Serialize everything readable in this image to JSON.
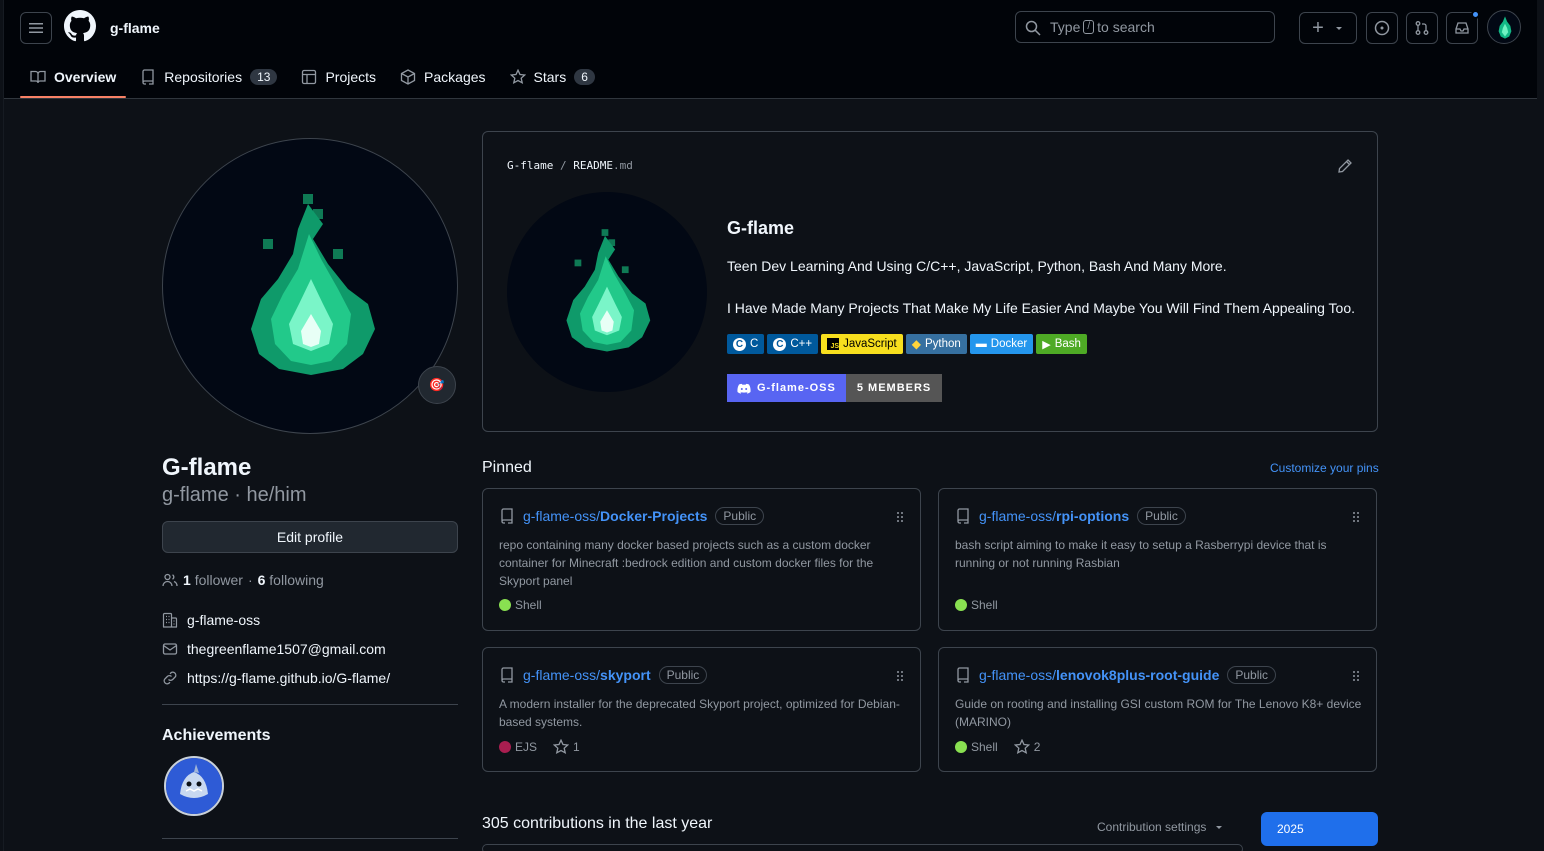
{
  "header": {
    "username": "g-flame",
    "search": {
      "prefix": "Type",
      "key": "/",
      "suffix": "to search"
    },
    "plus_label": "+"
  },
  "tabs": [
    {
      "label": "Overview",
      "active": true
    },
    {
      "label": "Repositories",
      "count": "13"
    },
    {
      "label": "Projects"
    },
    {
      "label": "Packages"
    },
    {
      "label": "Stars",
      "count": "6"
    }
  ],
  "profile": {
    "name": "G-flame",
    "login_pronouns": "g-flame · he/him",
    "edit_label": "Edit profile",
    "followers_count": "1",
    "followers_label": "follower",
    "separator": "·",
    "following_count": "6",
    "following_label": "following",
    "org": "g-flame-oss",
    "email": "thegreenflame1507@gmail.com",
    "website": "https://g-flame.github.io/G-flame/",
    "achievements_title": "Achievements"
  },
  "readme": {
    "path_user": "G-flame",
    "path_sep": "/",
    "path_file": "README",
    "path_ext": ".md",
    "heading": "G-flame",
    "p1": "Teen Dev Learning And Using C/C++, JavaScript, Python, Bash And Many More.",
    "p2": "I Have Made Many Projects That Make My Life Easier And Maybe You Will Find Them Appealing Too.",
    "shields": [
      {
        "label": "C",
        "color": "#00599c",
        "icon": "c-icon"
      },
      {
        "label": "C++",
        "color": "#00599c",
        "icon": "cpp-icon"
      },
      {
        "label": "JavaScript",
        "color": "#f7df1e",
        "text": "#000000",
        "icon": "js-icon"
      },
      {
        "label": "Python",
        "color": "#3670a0",
        "icon": "python-icon"
      },
      {
        "label": "Docker",
        "color": "#0db7ed",
        "icon": "docker-icon"
      },
      {
        "label": "Bash",
        "color": "#4eaa25",
        "icon": "bash-icon"
      }
    ],
    "discord_name": "G-flame-OSS",
    "discord_members": "5 MEMBERS"
  },
  "pinned": {
    "title": "Pinned",
    "customize": "Customize your pins",
    "cards": [
      {
        "owner": "g-flame-oss/",
        "repo": "Docker-Projects",
        "visibility": "Public",
        "desc": "repo containing many docker based projects such as a custom docker container for Minecraft :bedrock edition and custom docker files for the Skyport panel",
        "lang": "Shell",
        "lang_color": "#89e051",
        "stars": ""
      },
      {
        "owner": "g-flame-oss/",
        "repo": "rpi-options",
        "visibility": "Public",
        "desc": "bash script aiming to make it easy to setup a Rasberrypi device that is running or not running Rasbian",
        "lang": "Shell",
        "lang_color": "#89e051",
        "stars": ""
      },
      {
        "owner": "g-flame-oss/",
        "repo": "skyport",
        "visibility": "Public",
        "desc": "A modern installer for the deprecated Skyport project, optimized for Debian-based systems.",
        "lang": "EJS",
        "lang_color": "#a91e50",
        "stars": "1"
      },
      {
        "owner": "g-flame-oss/",
        "repo": "lenovok8plus-root-guide",
        "visibility": "Public",
        "desc": "Guide on rooting and installing GSI custom ROM for The Lenovo K8+ device (MARINO)",
        "lang": "Shell",
        "lang_color": "#89e051",
        "stars": "2"
      }
    ]
  },
  "contributions": {
    "title": "305 contributions in the last year",
    "settings": "Contribution settings",
    "year": "2025"
  },
  "colors": {
    "accent": "#4493f8",
    "tab_underline": "#f78166",
    "flame": "#2ee59d"
  }
}
